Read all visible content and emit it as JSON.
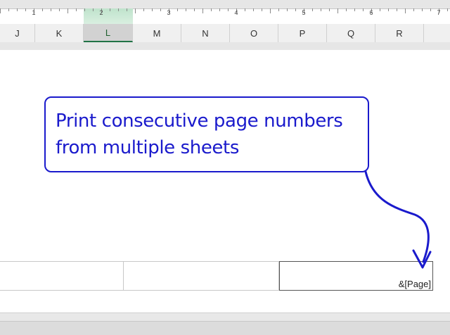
{
  "ruler": {
    "numbers": [
      "1",
      "2",
      "3",
      "4",
      "5",
      "6",
      "7"
    ]
  },
  "columns": [
    "J",
    "K",
    "L",
    "M",
    "N",
    "O",
    "P",
    "Q",
    "R"
  ],
  "selected_column": "L",
  "callout": {
    "line1": "Print consecutive page numbers",
    "line2": "from multiple sheets",
    "color": "#1a1acc"
  },
  "footer": {
    "right_text": "&[Page]"
  }
}
